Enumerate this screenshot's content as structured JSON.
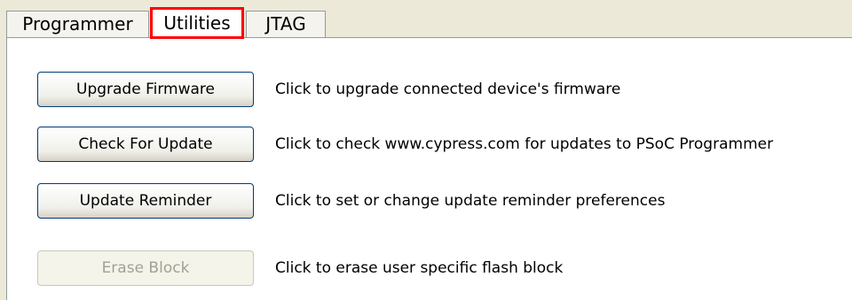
{
  "tabs": {
    "programmer": "Programmer",
    "utilities": "Utilities",
    "jtag": "JTAG",
    "selected": "Utilities"
  },
  "utilities": {
    "rows": [
      {
        "button": "Upgrade Firmware",
        "description": "Click to upgrade connected device's firmware",
        "enabled": true
      },
      {
        "button": "Check For Update",
        "description": "Click to check www.cypress.com for updates to PSoC Programmer",
        "enabled": true
      },
      {
        "button": "Update Reminder",
        "description": "Click to set or change update reminder preferences",
        "enabled": true
      },
      {
        "button": "Erase Block",
        "description": "Click to erase user specific flash block",
        "enabled": false
      }
    ]
  },
  "colors": {
    "highlight_border": "#ff0000",
    "button_border": "#003c74",
    "disabled_text": "#a1a192"
  }
}
